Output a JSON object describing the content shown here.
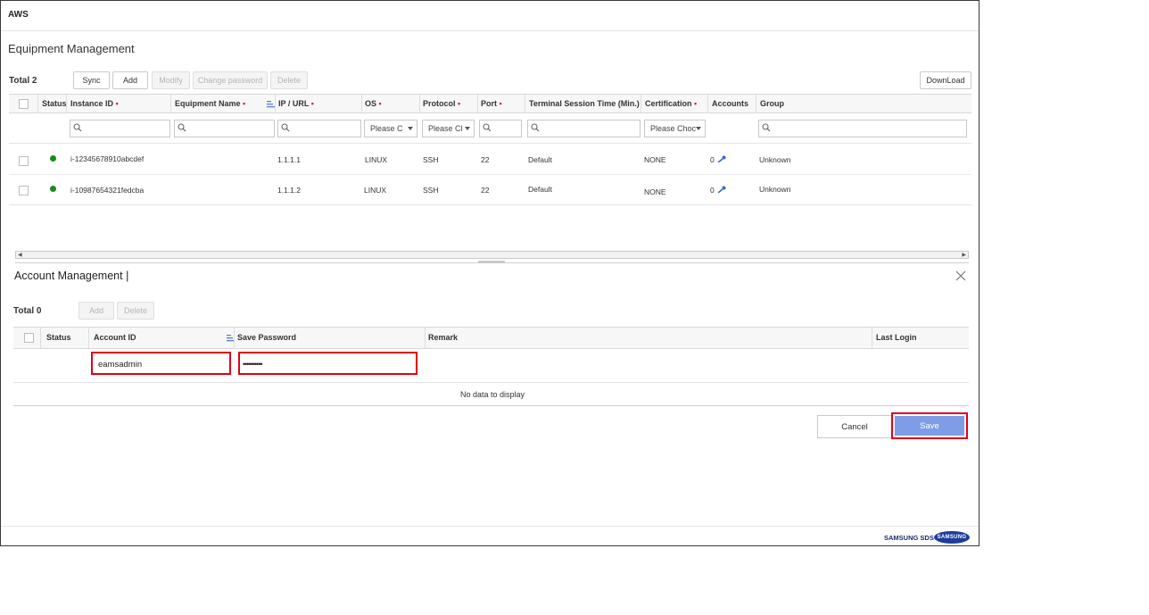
{
  "app": {
    "title": "AWS"
  },
  "equipment": {
    "title": "Equipment Management",
    "total_label": "Total 2",
    "toolbar": {
      "sync": "Sync",
      "add": "Add",
      "modify": "Modify",
      "change_password": "Change password",
      "delete": "Delete",
      "download": "DownLoad"
    },
    "columns": {
      "status": "Status",
      "instance_id": "Instance ID",
      "equipment_name": "Equipment Name",
      "ip_url": "IP / URL",
      "os": "OS",
      "protocol": "Protocol",
      "port": "Port",
      "terminal_session_time": "Terminal Session Time (Min.)",
      "certification": "Certification",
      "accounts": "Accounts",
      "group": "Group"
    },
    "required_mark": "•",
    "filters": {
      "os_placeholder": "Please C",
      "protocol_placeholder": "Please Cl",
      "certification_placeholder": "Please Choc"
    },
    "rows": [
      {
        "instance_id": "i-12345678910abcdef",
        "equipment_name": "",
        "ip": "1.1.1.1",
        "os": "LINUX",
        "protocol": "SSH",
        "port": "22",
        "session_time": "Default",
        "certification": "NONE",
        "accounts": "0",
        "group": "Unknown"
      },
      {
        "instance_id": "i-10987654321fedcba",
        "equipment_name": "",
        "ip": "1.1.1.2",
        "os": "LINUX",
        "protocol": "SSH",
        "port": "22",
        "session_time": "Default",
        "certification": "NONE",
        "accounts": "0",
        "group": "Unknown"
      }
    ],
    "status_color": "#1a8a1a"
  },
  "account": {
    "title": "Account Management |",
    "total_label": "Total 0",
    "toolbar": {
      "add": "Add",
      "delete": "Delete"
    },
    "columns": {
      "status": "Status",
      "account_id": "Account ID",
      "save_password": "Save Password",
      "remark": "Remark",
      "last_login": "Last Login"
    },
    "new_row": {
      "account_id": "eamsadmin",
      "password": "••••••••••"
    },
    "empty_message": "No data to display",
    "cancel": "Cancel",
    "save": "Save"
  },
  "footer": {
    "brand_text": "SAMSUNG SDS",
    "logo_text": "SAMSUNG"
  },
  "colors": {
    "highlight": "#e0001b",
    "primary_button": "#7f9de6",
    "required": "#d9232d"
  }
}
